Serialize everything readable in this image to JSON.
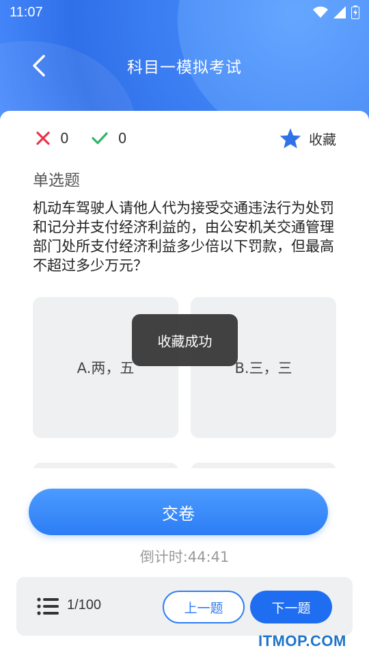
{
  "status_bar": {
    "time": "11:07"
  },
  "nav": {
    "title": "科目一模拟考试",
    "back_icon": "chevron-left-icon"
  },
  "score": {
    "wrong_count": "0",
    "right_count": "0",
    "favorite_label": "收藏"
  },
  "question": {
    "type": "单选题",
    "text": "机动车驾驶人请他人代为接受交通违法行为处罚和记分并支付经济利益的，由公安机关交通管理部门处所支付经济利益多少倍以下罚款，但最高不超过多少万元？",
    "options": [
      {
        "label": "A.两，五"
      },
      {
        "label": "B.三，三"
      }
    ]
  },
  "toast": {
    "text": "收藏成功"
  },
  "actions": {
    "submit_label": "交卷",
    "countdown": "倒计时:44:41"
  },
  "bottom_bar": {
    "progress": "1/100",
    "prev_label": "上一题",
    "next_label": "下一题"
  },
  "watermark": "ITMOP.COM",
  "colors": {
    "primary": "#2c7df5",
    "wrong": "#e8344c",
    "right": "#2fb36b",
    "star": "#2f72e8"
  }
}
